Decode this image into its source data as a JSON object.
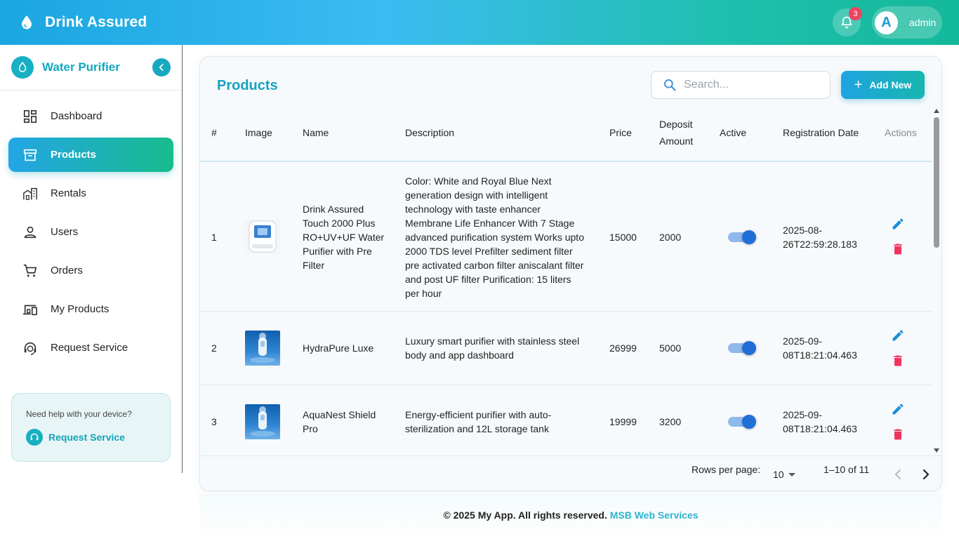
{
  "header": {
    "title": "Drink Assured",
    "notification_count": "3",
    "avatar_letter": "A",
    "username": "admin"
  },
  "sidebar": {
    "title": "Water Purifier",
    "items": [
      {
        "label": "Dashboard",
        "icon": "dashboard-icon",
        "active": false
      },
      {
        "label": "Products",
        "icon": "archive-box-icon",
        "active": true
      },
      {
        "label": "Rentals",
        "icon": "buildings-icon",
        "active": false
      },
      {
        "label": "Users",
        "icon": "person-icon",
        "active": false
      },
      {
        "label": "Orders",
        "icon": "cart-icon",
        "active": false
      },
      {
        "label": "My Products",
        "icon": "devices-icon",
        "active": false
      },
      {
        "label": "Request Service",
        "icon": "support-agent-icon",
        "active": false
      }
    ],
    "help": {
      "text": "Need help with your device?",
      "link": "Request Service"
    }
  },
  "main": {
    "title": "Products",
    "search_placeholder": "Search...",
    "add_label": "Add New",
    "columns": [
      "#",
      "Image",
      "Name",
      "Description",
      "Price",
      "Deposit Amount",
      "Active",
      "Registration Date",
      "Actions"
    ],
    "rows": [
      {
        "num": "1",
        "name": "Drink Assured Touch 2000 Plus RO+UV+UF Water Purifier with Pre Filter",
        "description": "Color: White and Royal Blue Next generation design with intelligent technology with taste enhancer Membrane Life Enhancer With 7 Stage advanced purification system Works upto 2000 TDS level Prefilter sediment filter pre activated carbon filter aniscalant filter and post UF filter Purification: 15 liters per hour",
        "price": "15000",
        "deposit": "2000",
        "active": true,
        "date_line1": "2025-08-",
        "date_line2": "26T22:59:28.183"
      },
      {
        "num": "2",
        "name": "HydraPure Luxe",
        "description": "Luxury smart purifier with stainless steel body and app dashboard",
        "price": "26999",
        "deposit": "5000",
        "active": true,
        "date_line1": "2025-09-",
        "date_line2": "08T18:21:04.463"
      },
      {
        "num": "3",
        "name": "AquaNest Shield Pro",
        "description": "Energy-efficient purifier with auto-sterilization and 12L storage tank",
        "price": "19999",
        "deposit": "3200",
        "active": true,
        "date_line1": "2025-09-",
        "date_line2": "08T18:21:04.463"
      }
    ],
    "pagination": {
      "rows_per_page_label": "Rows per page:",
      "rows_per_page": "10",
      "range": "1–10 of 11"
    }
  },
  "footer": {
    "text": "© 2025 My App. All rights reserved.",
    "link": "MSB Web Services"
  },
  "colors": {
    "accent": "#17a3c1",
    "edit": "#1a8fd8",
    "delete": "#f0345e"
  }
}
